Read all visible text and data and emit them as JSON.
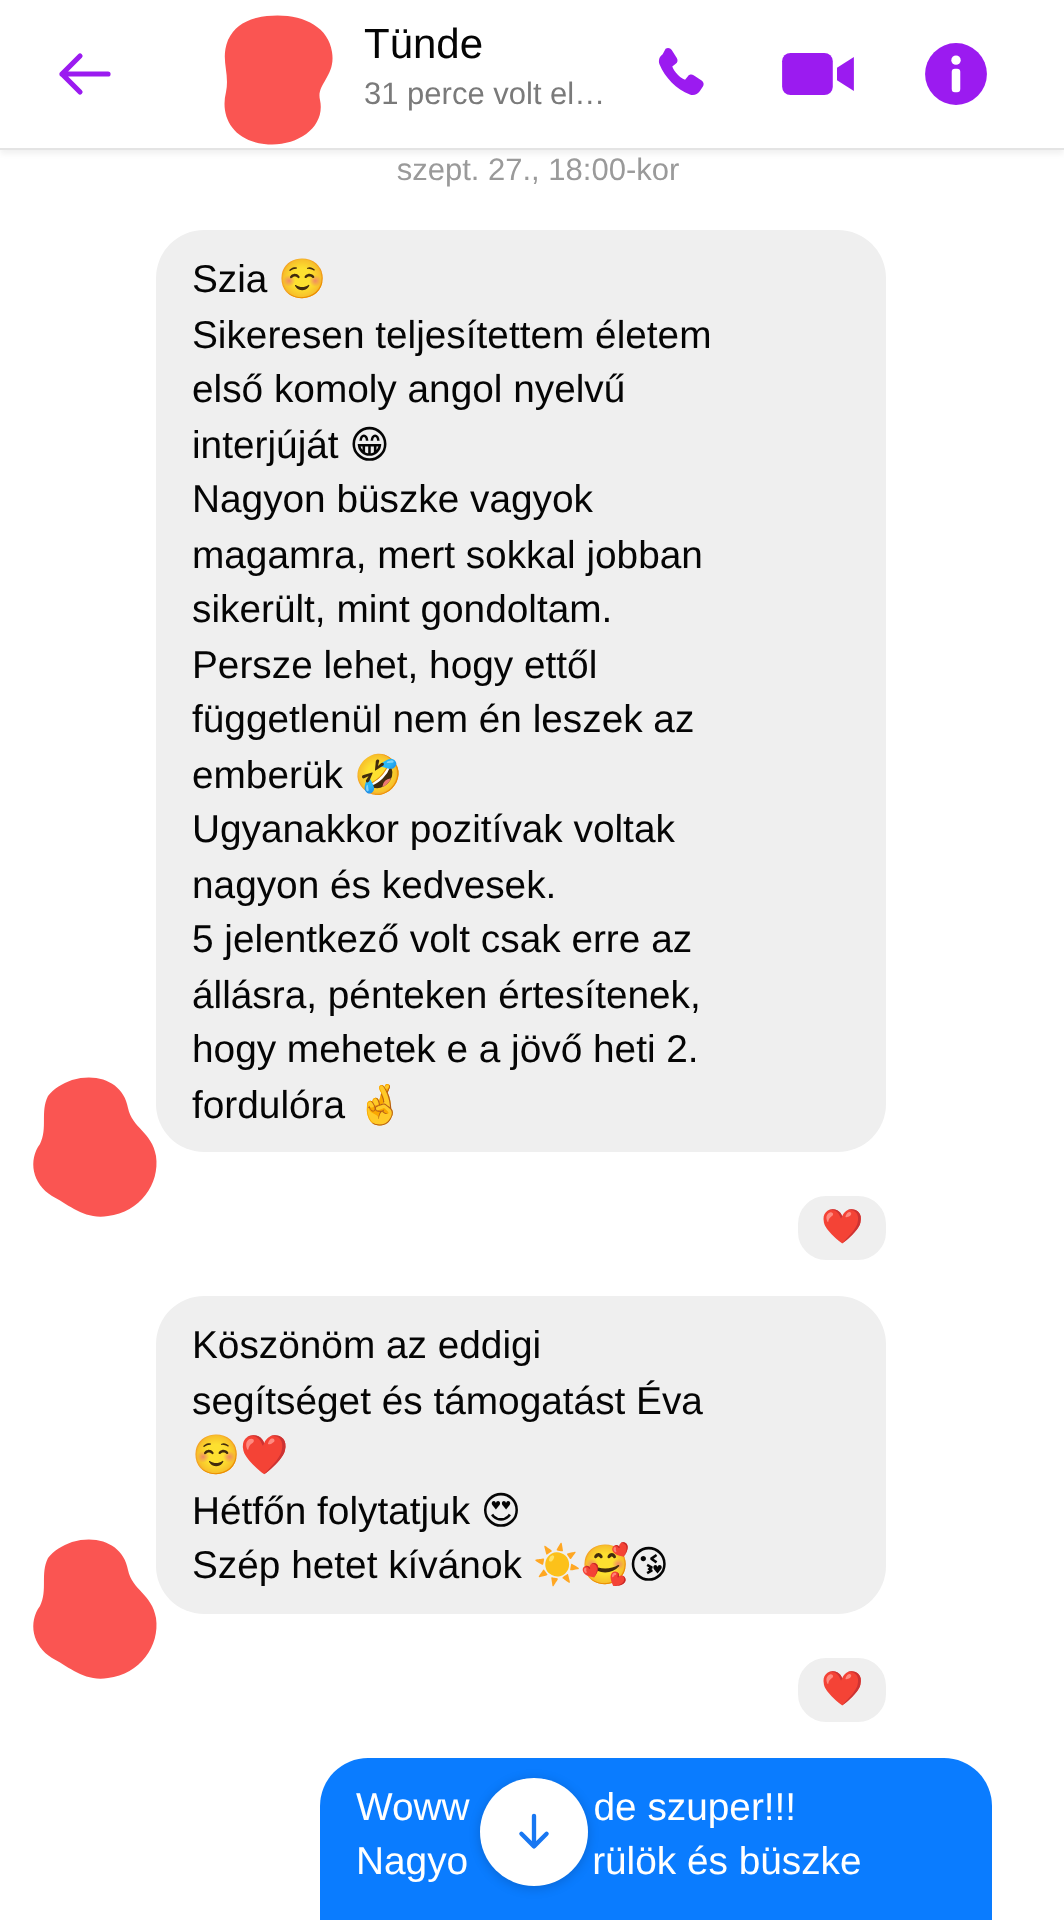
{
  "header": {
    "name": "Tünde",
    "status": "31 perce volt el…"
  },
  "timestamp": "szept. 27., 18:00-kor",
  "messages": [
    {
      "kind": "received",
      "avatar": true,
      "lines": [
        [
          "Szia ☺️"
        ],
        [
          "Sikeresen teljesítettem életem"
        ],
        [
          "első komoly angol nyelvű"
        ],
        [
          "interjúját 😁"
        ],
        [
          "Nagyon büszke vagyok"
        ],
        [
          "magamra, mert sokkal jobban"
        ],
        [
          "sikerült, mint gondoltam."
        ],
        [
          "Persze lehet, hogy ettől"
        ],
        [
          "függetlenül nem én leszek az"
        ],
        [
          "emberük 🤣"
        ],
        [
          "Ugyanakkor pozitívak voltak"
        ],
        [
          "nagyon és kedvesek."
        ],
        [
          "5 jelentkező volt csak erre az"
        ],
        [
          "állásra, pénteken értesítenek,"
        ],
        [
          "hogy mehetek e a jövő heti 2."
        ],
        [
          "fordulóra 🤞"
        ]
      ],
      "reaction": "❤️"
    },
    {
      "kind": "received",
      "avatar": true,
      "lines": [
        [
          "Köszönöm az eddigi"
        ],
        [
          "segítséget és támogatást Éva"
        ],
        [
          "☺️❤️"
        ],
        [
          "Hétfőn folytatjuk 😍"
        ],
        [
          "Szép hetet kívánok ☀️🥰😘"
        ]
      ],
      "reaction": "❤️"
    },
    {
      "kind": "sent",
      "lines": [
        [
          "Woww",
          "de szuper!!!"
        ],
        [
          "Nagyo",
          "rülök és büszke"
        ]
      ]
    }
  ]
}
